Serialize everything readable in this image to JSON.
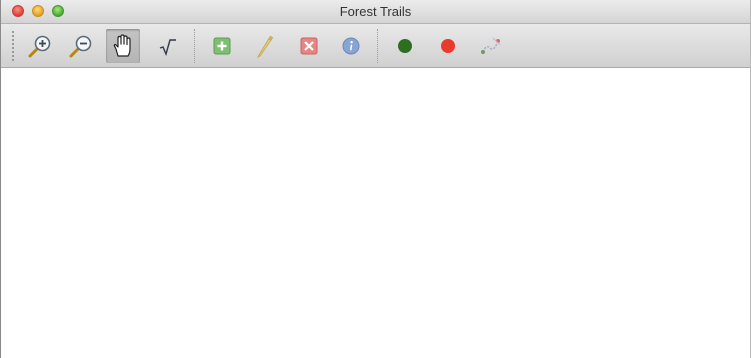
{
  "window": {
    "title": "Forest Trails"
  },
  "toolbar": {
    "buttons": [
      {
        "id": "zoom-in",
        "icon": "zoom-in-icon",
        "active": false
      },
      {
        "id": "zoom-out",
        "icon": "zoom-out-icon",
        "active": false
      },
      {
        "id": "pan",
        "icon": "pan-hand-icon",
        "active": true
      },
      {
        "id": "calculator",
        "icon": "square-root-icon",
        "active": false
      },
      {
        "id": "add",
        "icon": "add-icon",
        "active": false
      },
      {
        "id": "edit",
        "icon": "pencil-icon",
        "active": false
      },
      {
        "id": "delete",
        "icon": "delete-icon",
        "active": false
      },
      {
        "id": "info",
        "icon": "info-icon",
        "active": false
      },
      {
        "id": "start-point",
        "icon": "green-dot-icon",
        "active": false
      },
      {
        "id": "end-point",
        "icon": "red-dot-icon",
        "active": false
      },
      {
        "id": "route",
        "icon": "route-icon",
        "active": false
      }
    ]
  },
  "colors": {
    "start_point": "#2e6e1f",
    "end_point": "#ea3a2b",
    "disabled_add": "#77b86b",
    "disabled_delete": "#e07a78",
    "disabled_info": "#7b97c9"
  }
}
